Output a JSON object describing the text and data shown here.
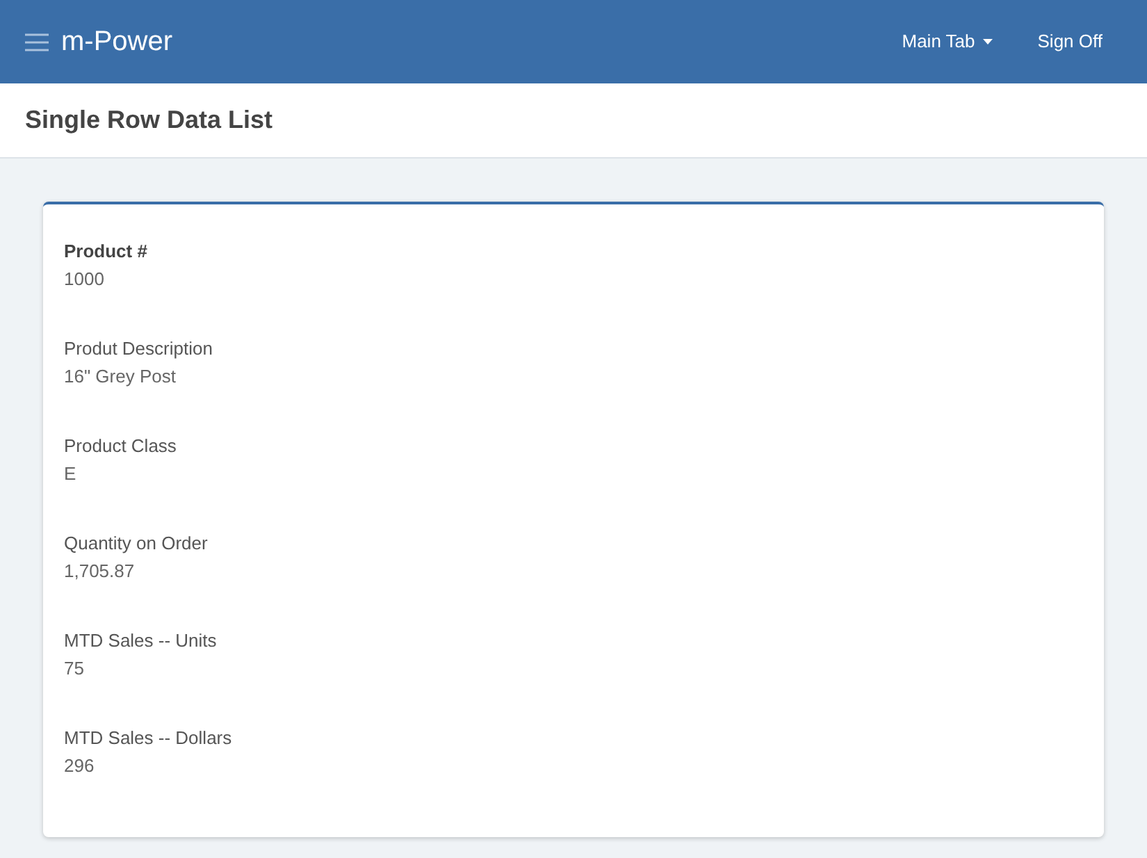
{
  "navbar": {
    "brand": "m-Power",
    "menu": [
      {
        "label": "Main Tab",
        "kind": "dropdown"
      },
      {
        "label": "Sign Off",
        "kind": "link"
      }
    ]
  },
  "page_title": "Single Row Data List",
  "fields": [
    {
      "label": "Product #",
      "value": "1000",
      "bold": true
    },
    {
      "label": "Produt Description",
      "value": "16\" Grey Post",
      "bold": false
    },
    {
      "label": "Product Class",
      "value": "E",
      "bold": false
    },
    {
      "label": "Quantity on Order",
      "value": "1,705.87",
      "bold": false
    },
    {
      "label": "MTD Sales -- Units",
      "value": "75",
      "bold": false
    },
    {
      "label": "MTD Sales -- Dollars",
      "value": "296",
      "bold": false
    }
  ]
}
